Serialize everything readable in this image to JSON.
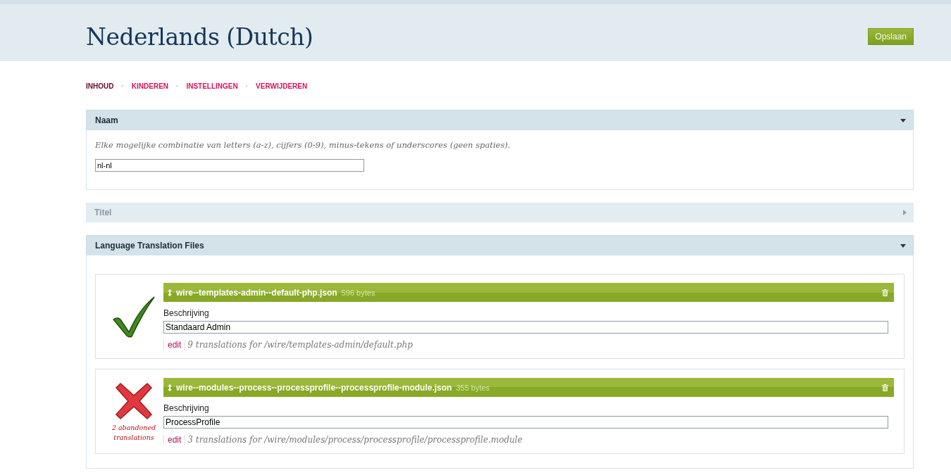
{
  "header": {
    "title": "Nederlands (Dutch)",
    "save_button": "Opslaan"
  },
  "tabs": [
    {
      "label": "INHOUD",
      "selected": true
    },
    {
      "label": "KINDEREN",
      "selected": false
    },
    {
      "label": "INSTELLINGEN",
      "selected": false
    },
    {
      "label": "VERWIJDEREN",
      "selected": false
    }
  ],
  "tab_separator": "·",
  "panels": [
    {
      "title": "Naam",
      "expanded": true,
      "kind": "name",
      "description": "Elke mogelijke combinatie van letters (a-z), cijfers (0-9), minus-tekens of underscores (geen spaties).",
      "value": "nl-nl"
    },
    {
      "title": "Titel",
      "expanded": false
    },
    {
      "title": "Language Translation Files",
      "expanded": true,
      "kind": "files",
      "files": [
        {
          "kind": "ok",
          "name": "wire--templates-admin--default-php.json",
          "size": "596 bytes",
          "label": "Beschrijving",
          "value": "Standaard Admin",
          "edit": "edit",
          "info": "9 translations for /wire/templates-admin/default.php"
        },
        {
          "kind": "error",
          "note": "2 abandoned translations",
          "name": "wire--modules--process--processprofile--processprofile-module.json",
          "size": "355 bytes",
          "label": "Beschrijving",
          "value": "ProcessProfile",
          "edit": "edit",
          "info": "3 translations for /wire/modules/process/processprofile/processprofile.module"
        }
      ]
    }
  ]
}
